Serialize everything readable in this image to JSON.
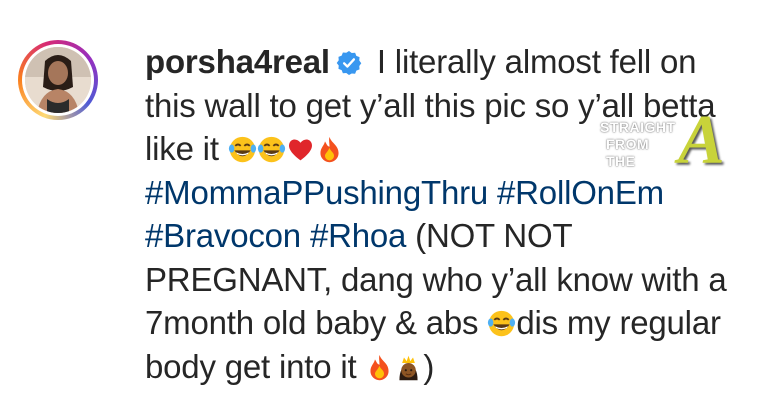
{
  "post": {
    "username": "porsha4real",
    "caption": {
      "line1_text": " I literally almost fell on this wall to get y’all this pic so y’all betta like it ",
      "hashtags": [
        "#MommaPPushingThru",
        "#RollOnEm",
        "#Bravocon",
        "#Rhoa"
      ],
      "middle_text": " (NOT NOT PREGNANT, dang who y’all know with a 7month old baby & abs ",
      "after_laugh_text": "dis my regular body get into it ",
      "closing": ")"
    }
  },
  "watermark": {
    "line1": "STRAIGHT",
    "line2": "FROM",
    "line3": "THE",
    "letter": "A"
  },
  "icons": {
    "verified": "verified-badge-icon",
    "emojis": [
      "face-with-tears-of-joy-icon",
      "red-heart-icon",
      "fire-icon",
      "crown-princess-icon"
    ]
  },
  "colors": {
    "username": "#262626",
    "hashtag": "#00376b",
    "verified": "#3897f0"
  }
}
